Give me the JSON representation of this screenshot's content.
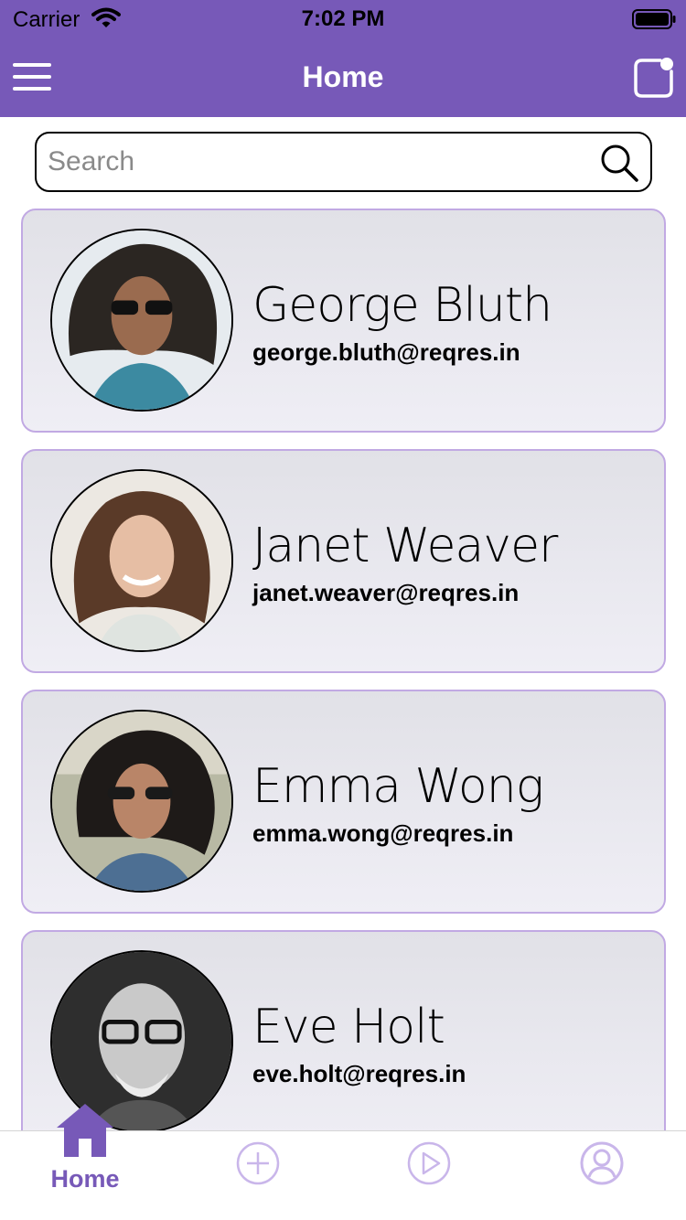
{
  "status_bar": {
    "carrier": "Carrier",
    "time": "7:02 PM"
  },
  "nav": {
    "title": "Home"
  },
  "search": {
    "placeholder": "Search",
    "value": ""
  },
  "users": [
    {
      "name": "George Bluth",
      "email": "george.bluth@reqres.in"
    },
    {
      "name": "Janet Weaver",
      "email": "janet.weaver@reqres.in"
    },
    {
      "name": "Emma Wong",
      "email": "emma.wong@reqres.in"
    },
    {
      "name": "Eve Holt",
      "email": "eve.holt@reqres.in"
    }
  ],
  "tabs": [
    {
      "label": "Home",
      "icon": "home-icon",
      "active": true
    },
    {
      "label": "",
      "icon": "add-icon",
      "active": false
    },
    {
      "label": "",
      "icon": "play-icon",
      "active": false
    },
    {
      "label": "",
      "icon": "profile-icon",
      "active": false
    }
  ],
  "colors": {
    "primary": "#7759b8",
    "card_border": "#c1a9e3",
    "inactive_icon": "#c9b6ea"
  }
}
